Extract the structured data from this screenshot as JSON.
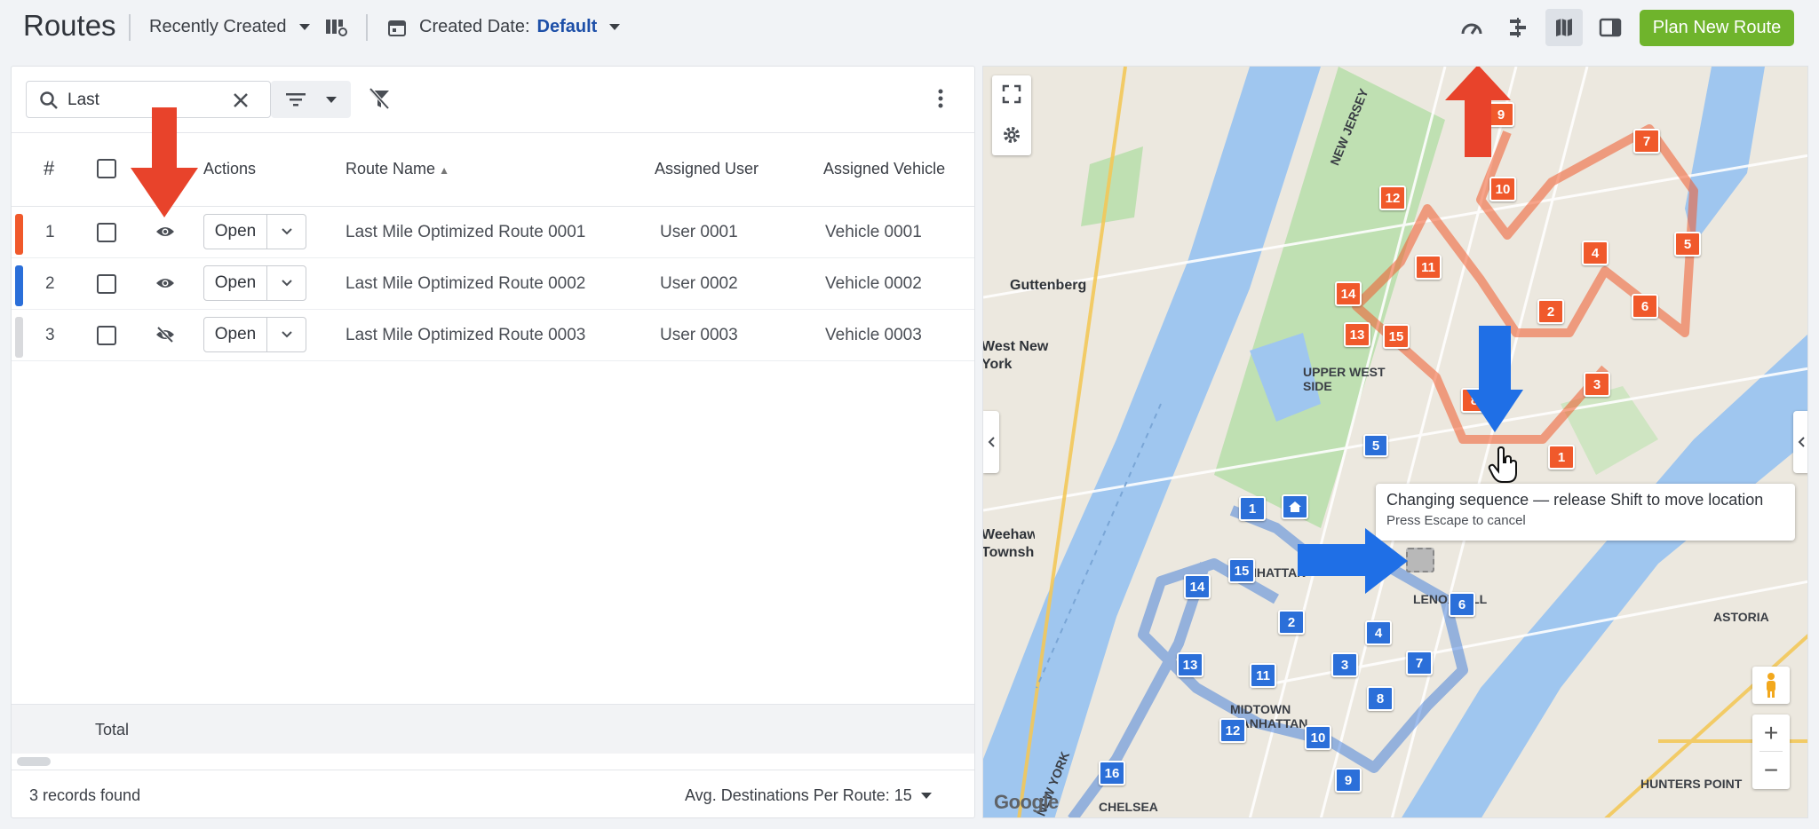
{
  "header": {
    "title": "Routes",
    "sort_label": "Recently Created",
    "date_label": "Created Date:",
    "date_value": "Default",
    "plan_button": "Plan New Route"
  },
  "toolbar": {
    "search_value": "Last"
  },
  "table": {
    "columns": [
      "#",
      "Actions",
      "Route Name",
      "Assigned User",
      "Assigned Vehicle"
    ],
    "open_label": "Open",
    "rows": [
      {
        "num": "1",
        "route": "Last Mile Optimized Route 0001",
        "user": "User 0001",
        "vehicle": "Vehicle 0001",
        "color": "#f0592b",
        "visible": true
      },
      {
        "num": "2",
        "route": "Last Mile Optimized Route 0002",
        "user": "User 0002",
        "vehicle": "Vehicle 0002",
        "color": "#2b6fd9",
        "visible": true
      },
      {
        "num": "3",
        "route": "Last Mile Optimized Route 0003",
        "user": "User 0003",
        "vehicle": "Vehicle 0003",
        "color": "#d9dadd",
        "visible": false
      }
    ],
    "total_label": "Total"
  },
  "footer": {
    "records": "3 records found",
    "avg": "Avg. Destinations Per Route: 15"
  },
  "map": {
    "labels": [
      "Guttenberg",
      "West New York",
      "UPPER WEST SIDE",
      "MANHATTAN",
      "MIDTOWN MANHATTAN",
      "LENOX HILL",
      "ASTORIA",
      "HUNTERS POINT",
      "CHELSEA",
      "NEW JERSEY",
      "NEW YORK",
      "Weehawken Township"
    ],
    "tooltip_title": "Changing sequence — release Shift to move location",
    "tooltip_sub": "Press Escape to cancel",
    "google": "Google",
    "orange_markers": [
      "9",
      "7",
      "12",
      "10",
      "5",
      "4",
      "11",
      "14",
      "2",
      "6",
      "13",
      "15",
      "3",
      "1",
      "8"
    ],
    "blue_markers": [
      "1",
      "15",
      "14",
      "2",
      "4",
      "6",
      "3",
      "7",
      "13",
      "11",
      "8",
      "12",
      "10",
      "16",
      "9",
      "5"
    ],
    "colors": {
      "route1": "#f0592b",
      "route2": "#2b6fd9",
      "water": "#9fc6ef",
      "park": "#bfe0b2"
    }
  }
}
